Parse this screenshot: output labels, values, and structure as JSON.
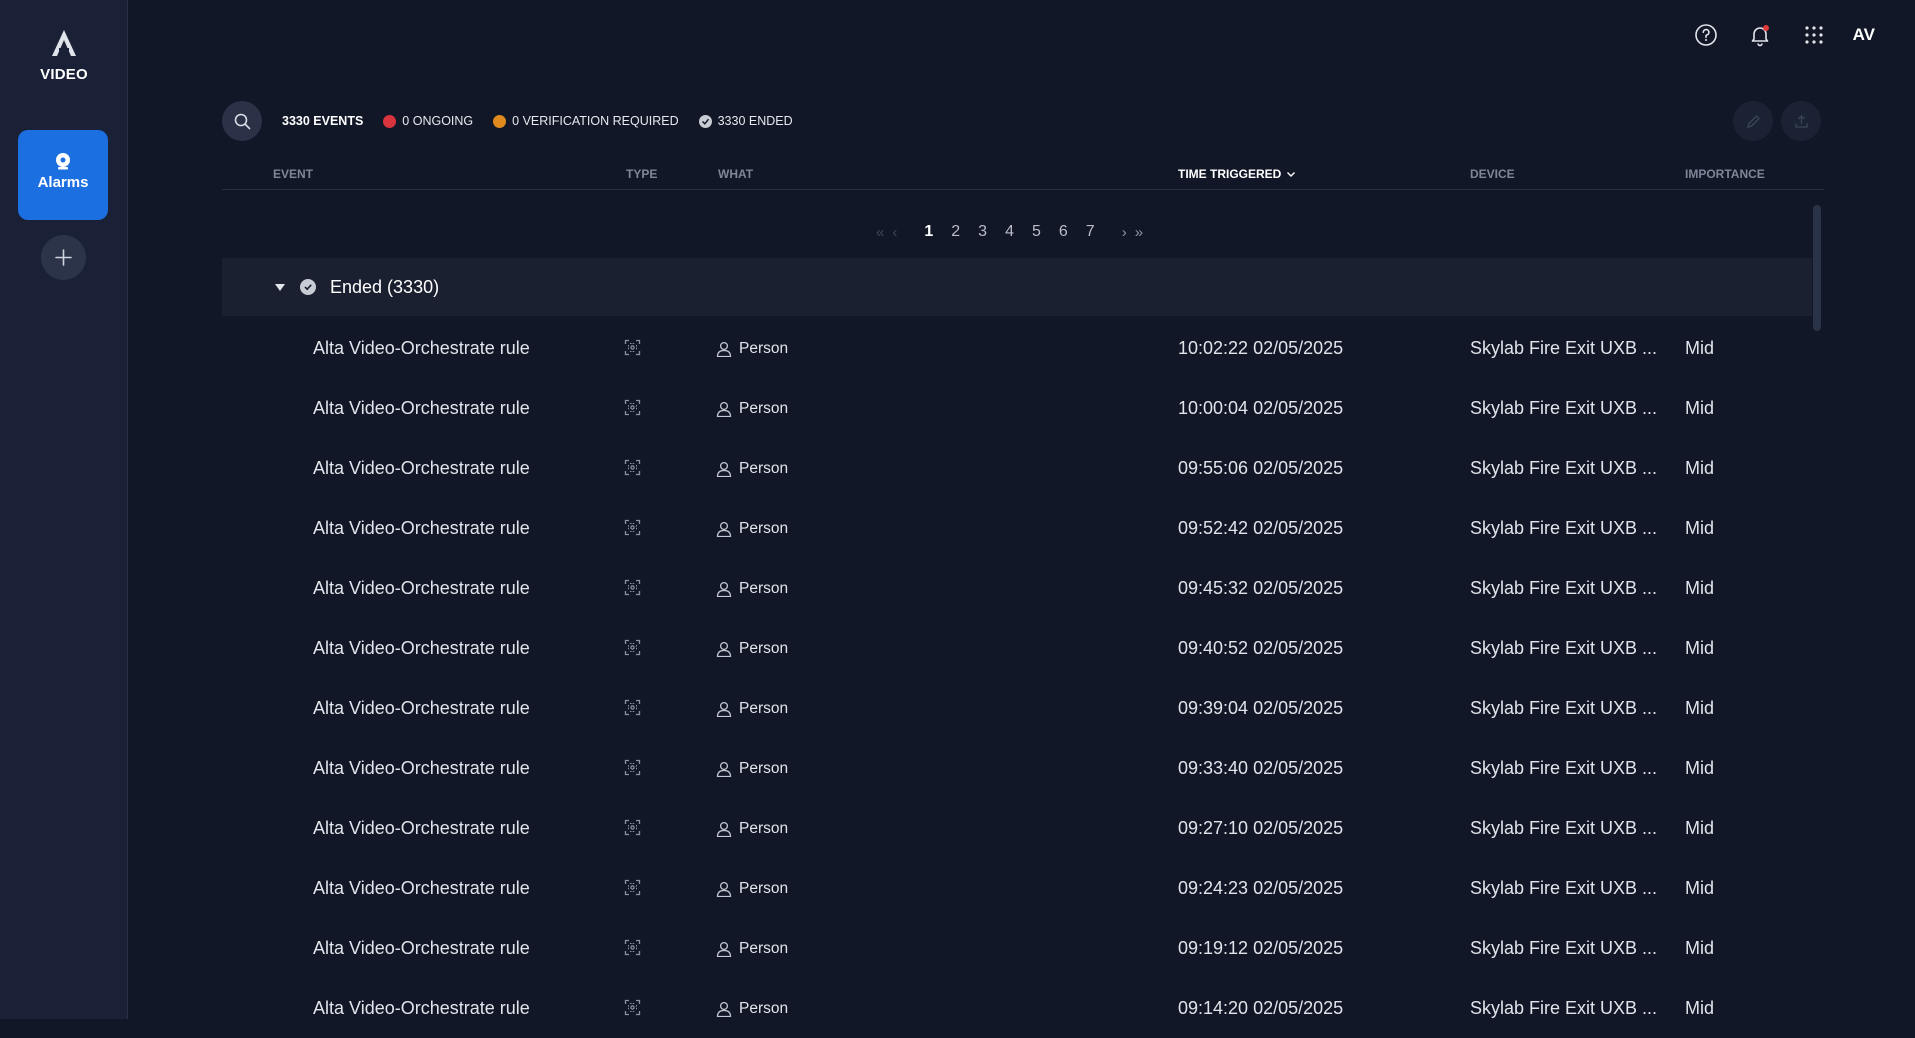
{
  "app": {
    "name": "VIDEO",
    "avatar_initials": "AV"
  },
  "sidebar": {
    "alarms_label": "Alarms"
  },
  "summary": {
    "total": "3330 EVENTS",
    "ongoing": "0 ONGOING",
    "verification": "0 VERIFICATION REQUIRED",
    "ended": "3330 ENDED"
  },
  "table": {
    "headers": {
      "event": "EVENT",
      "type": "TYPE",
      "what": "WHAT",
      "time": "TIME TRIGGERED",
      "device": "DEVICE",
      "importance": "IMPORTANCE"
    },
    "sort": {
      "column": "time",
      "direction": "descending"
    },
    "pagination": {
      "pages": [
        "1",
        "2",
        "3",
        "4",
        "5",
        "6",
        "7"
      ],
      "current": "1"
    },
    "group": {
      "label": "Ended (3330)"
    },
    "rows": [
      {
        "event": "Alta Video-Orchestrate rule",
        "what": "Person",
        "time": "10:02:22 02/05/2025",
        "device": "Skylab Fire Exit UXB ...",
        "importance": "Mid"
      },
      {
        "event": "Alta Video-Orchestrate rule",
        "what": "Person",
        "time": "10:00:04 02/05/2025",
        "device": "Skylab Fire Exit UXB ...",
        "importance": "Mid"
      },
      {
        "event": "Alta Video-Orchestrate rule",
        "what": "Person",
        "time": "09:55:06 02/05/2025",
        "device": "Skylab Fire Exit UXB ...",
        "importance": "Mid"
      },
      {
        "event": "Alta Video-Orchestrate rule",
        "what": "Person",
        "time": "09:52:42 02/05/2025",
        "device": "Skylab Fire Exit UXB ...",
        "importance": "Mid"
      },
      {
        "event": "Alta Video-Orchestrate rule",
        "what": "Person",
        "time": "09:45:32 02/05/2025",
        "device": "Skylab Fire Exit UXB ...",
        "importance": "Mid"
      },
      {
        "event": "Alta Video-Orchestrate rule",
        "what": "Person",
        "time": "09:40:52 02/05/2025",
        "device": "Skylab Fire Exit UXB ...",
        "importance": "Mid"
      },
      {
        "event": "Alta Video-Orchestrate rule",
        "what": "Person",
        "time": "09:39:04 02/05/2025",
        "device": "Skylab Fire Exit UXB ...",
        "importance": "Mid"
      },
      {
        "event": "Alta Video-Orchestrate rule",
        "what": "Person",
        "time": "09:33:40 02/05/2025",
        "device": "Skylab Fire Exit UXB ...",
        "importance": "Mid"
      },
      {
        "event": "Alta Video-Orchestrate rule",
        "what": "Person",
        "time": "09:27:10 02/05/2025",
        "device": "Skylab Fire Exit UXB ...",
        "importance": "Mid"
      },
      {
        "event": "Alta Video-Orchestrate rule",
        "what": "Person",
        "time": "09:24:23 02/05/2025",
        "device": "Skylab Fire Exit UXB ...",
        "importance": "Mid"
      },
      {
        "event": "Alta Video-Orchestrate rule",
        "what": "Person",
        "time": "09:19:12 02/05/2025",
        "device": "Skylab Fire Exit UXB ...",
        "importance": "Mid"
      },
      {
        "event": "Alta Video-Orchestrate rule",
        "what": "Person",
        "time": "09:14:20 02/05/2025",
        "device": "Skylab Fire Exit UXB ...",
        "importance": "Mid"
      }
    ]
  },
  "icons": {
    "logo": "alta-logo-icon",
    "alarms": "alarm-icon",
    "add": "plus-icon",
    "help": "help-icon",
    "notifications": "bell-icon",
    "apps": "grid-icon",
    "search": "search-icon",
    "edit": "pencil-icon",
    "export": "upload-icon",
    "row_type": "analytics-rule-icon",
    "row_what": "person-icon"
  },
  "colors": {
    "background": "#111726",
    "sidebar": "#1a2035",
    "accent": "#1c6fe0",
    "ongoing": "#d9343d",
    "verification": "#e08a1e",
    "ended": "#c8ccd4",
    "notification_dot": "#e23b3b"
  }
}
